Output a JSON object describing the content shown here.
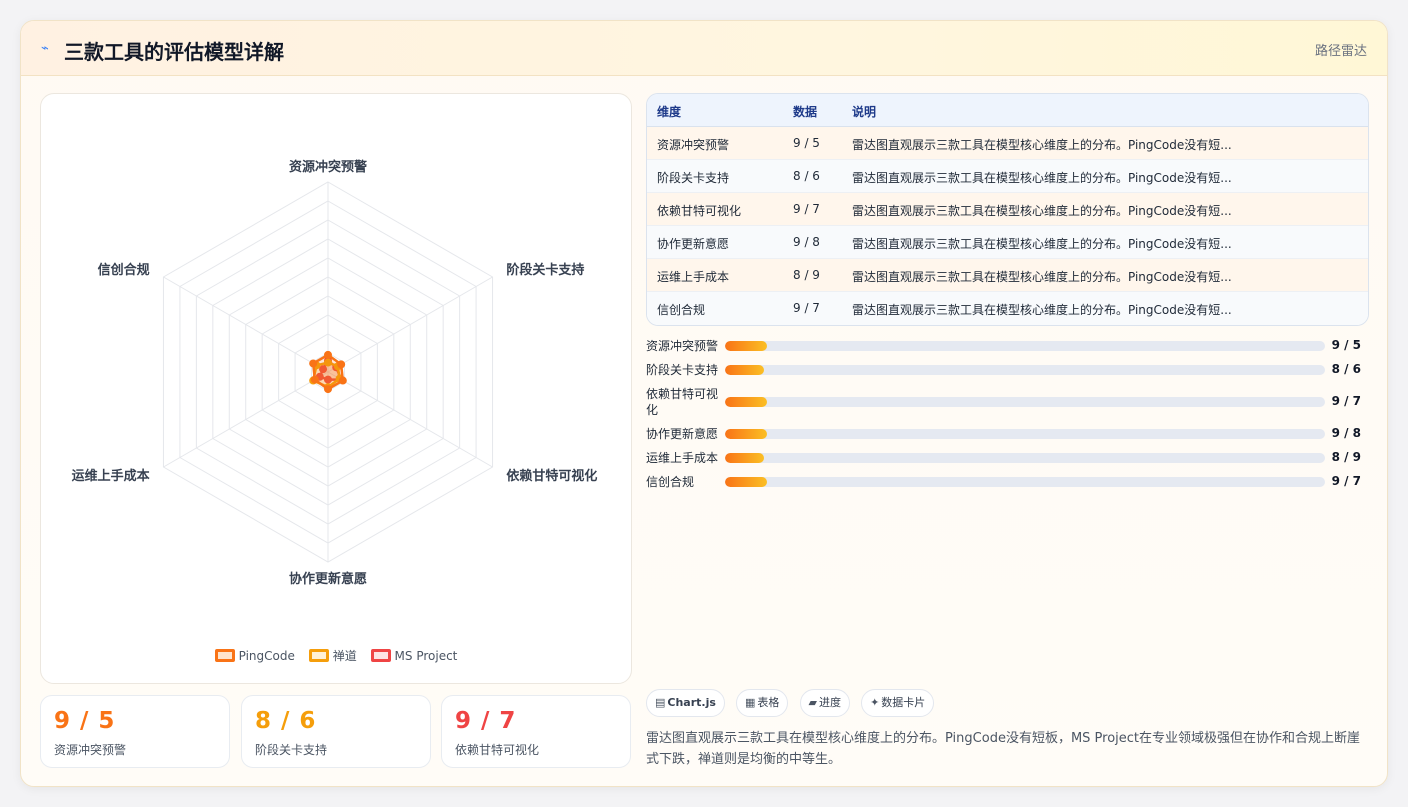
{
  "header": {
    "icon": "chart-line-icon",
    "title": "三款工具的评估模型详解",
    "tag": "路径雷达"
  },
  "chart_data": {
    "type": "radar",
    "axes": [
      "资源冲突预警",
      "阶段关卡支持",
      "依赖甘特可视化",
      "协作更新意愿",
      "运维上手成本",
      "信创合规"
    ],
    "series": [
      {
        "name": "PingCode",
        "values": [
          9,
          8,
          9,
          9,
          8,
          9
        ],
        "color": "#f97316"
      },
      {
        "name": "禅道",
        "values": [
          5,
          6,
          7,
          8,
          9,
          7
        ],
        "color": "#f59e0b"
      },
      {
        "name": "MS Project",
        "values": [
          6,
          5,
          8,
          4,
          5,
          3
        ],
        "color": "#ef4444"
      }
    ],
    "rlim": [
      0,
      100
    ],
    "ticks": 10,
    "legend_position": "bottom"
  },
  "stats": [
    {
      "value": "9 / 5",
      "label": "资源冲突预警",
      "color": "#f97316"
    },
    {
      "value": "8 / 6",
      "label": "阶段关卡支持",
      "color": "#f59e0b"
    },
    {
      "value": "9 / 7",
      "label": "依赖甘特可视化",
      "color": "#ef4444"
    }
  ],
  "table": {
    "headers": [
      "维度",
      "数据",
      "说明"
    ],
    "rows": [
      {
        "dim": "资源冲突预警",
        "data": "9 / 5",
        "note": "雷达图直观展示三款工具在模型核心维度上的分布。PingCode没有短..."
      },
      {
        "dim": "阶段关卡支持",
        "data": "8 / 6",
        "note": "雷达图直观展示三款工具在模型核心维度上的分布。PingCode没有短..."
      },
      {
        "dim": "依赖甘特可视化",
        "data": "9 / 7",
        "note": "雷达图直观展示三款工具在模型核心维度上的分布。PingCode没有短..."
      },
      {
        "dim": "协作更新意愿",
        "data": "9 / 8",
        "note": "雷达图直观展示三款工具在模型核心维度上的分布。PingCode没有短..."
      },
      {
        "dim": "运维上手成本",
        "data": "8 / 9",
        "note": "雷达图直观展示三款工具在模型核心维度上的分布。PingCode没有短..."
      },
      {
        "dim": "信创合规",
        "data": "9 / 7",
        "note": "雷达图直观展示三款工具在模型核心维度上的分布。PingCode没有短..."
      }
    ]
  },
  "progress": [
    {
      "label": "资源冲突预警",
      "value": "9 / 5",
      "fill": 7
    },
    {
      "label": "阶段关卡支持",
      "value": "8 / 6",
      "fill": 6.5
    },
    {
      "label": "依赖甘特可视化",
      "value": "9 / 7",
      "fill": 7
    },
    {
      "label": "协作更新意愿",
      "value": "9 / 8",
      "fill": 7
    },
    {
      "label": "运维上手成本",
      "value": "8 / 9",
      "fill": 6.5
    },
    {
      "label": "信创合规",
      "value": "9 / 7",
      "fill": 7
    }
  ],
  "chips": [
    {
      "icon": "▤",
      "label": "Chart.js"
    },
    {
      "icon": "▦",
      "label": "表格"
    },
    {
      "icon": "▰",
      "label": "进度"
    },
    {
      "icon": "✦",
      "label": "数据卡片"
    }
  ],
  "description": "雷达图直观展示三款工具在模型核心维度上的分布。PingCode没有短板，MS Project在专业领域极强但在协作和合规上断崖式下跌，禅道则是均衡的中等生。"
}
